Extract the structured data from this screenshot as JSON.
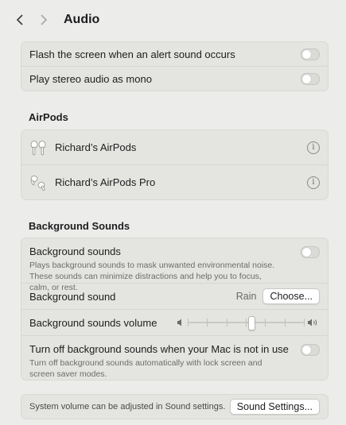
{
  "header": {
    "title": "Audio"
  },
  "general": {
    "items": [
      {
        "label": "Flash the screen when an alert sound occurs",
        "enabled": false
      },
      {
        "label": "Play stereo audio as mono",
        "enabled": false
      }
    ]
  },
  "airpods": {
    "title": "AirPods",
    "devices": [
      {
        "name": "Richard’s AirPods",
        "icon": "airpods-icon"
      },
      {
        "name": "Richard’s AirPods Pro",
        "icon": "airpods-pro-icon"
      }
    ]
  },
  "background": {
    "title": "Background Sounds",
    "toggle": {
      "label": "Background sounds",
      "description": "Plays background sounds to mask unwanted environmental noise. These sounds can minimize distractions and help you to focus, calm, or rest.",
      "enabled": false
    },
    "sound": {
      "label": "Background sound",
      "value": "Rain",
      "button": "Choose..."
    },
    "volume": {
      "label": "Background sounds volume",
      "level": 0.55
    },
    "auto_off": {
      "label": "Turn off background sounds when your Mac is not in use",
      "description": "Turn off background sounds automatically with lock screen and screen saver modes.",
      "enabled": false
    }
  },
  "footer": {
    "text": "System volume can be adjusted in Sound settings.",
    "button": "Sound Settings..."
  }
}
